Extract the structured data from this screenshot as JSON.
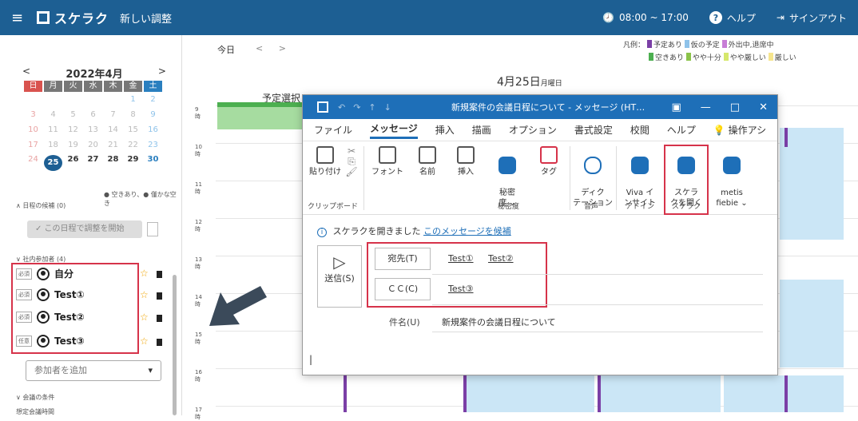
{
  "topbar": {
    "app_name": "スケラク",
    "page_title": "新しい調整",
    "hours": "08:00 ~ 17:00",
    "help": "ヘルプ",
    "signout": "サインアウト"
  },
  "calendar_mini": {
    "month_label": "2022年4月",
    "prev": "<",
    "next": ">",
    "weekdays": [
      "日",
      "月",
      "火",
      "水",
      "木",
      "金",
      "土"
    ],
    "weeks": [
      [
        "",
        "",
        "",
        "",
        "",
        "1",
        "2"
      ],
      [
        "3",
        "4",
        "5",
        "6",
        "7",
        "8",
        "9"
      ],
      [
        "10",
        "11",
        "12",
        "13",
        "14",
        "15",
        "16"
      ],
      [
        "17",
        "18",
        "19",
        "20",
        "21",
        "22",
        "23"
      ],
      [
        "24",
        "25",
        "26",
        "27",
        "28",
        "29",
        "30"
      ]
    ],
    "legend": "● 空きあり、● 僅かな空き"
  },
  "left": {
    "candidates_label": "∧ 日程の候補 (0)",
    "start_button": "✓ この日程で調整を開始",
    "participants_label": "∨ 社内参加者 (4)",
    "participants": [
      {
        "tag": "必須",
        "name": "自分"
      },
      {
        "tag": "必須",
        "name": "Test①"
      },
      {
        "tag": "必須",
        "name": "Test②"
      },
      {
        "tag": "任意",
        "name": "Test③"
      }
    ],
    "add_participant": "参加者を追加",
    "conditions_label": "∨ 会議の条件",
    "meeting_time_label": "想定会議時間"
  },
  "calendar": {
    "today": "今日",
    "nav": "< >",
    "legend_prefix": "凡例：",
    "legend_row1": [
      "予定あり",
      "仮の予定",
      "外出中,退席中"
    ],
    "legend_row2": [
      "空きあり",
      "やや十分",
      "やや厳しい",
      "厳しい"
    ],
    "legend_colors": [
      "#7b3fa6",
      "#8fc3ea",
      "#c77dd6",
      "#4caf50",
      "#8bc34a",
      "#d6e86c",
      "#f6e58d"
    ],
    "date_title": "4月25日",
    "date_weekday": "月曜日",
    "pick_label": "予定選択",
    "hours": [
      "9時",
      "10時",
      "11時",
      "12時",
      "13時",
      "14時",
      "15時",
      "16時",
      "17時"
    ]
  },
  "outlook": {
    "window_title": "新規案件の会議日程について - メッセージ (HT…",
    "menu": [
      "ファイル",
      "メッセージ",
      "挿入",
      "描画",
      "オプション",
      "書式設定",
      "校閲",
      "ヘルプ",
      "操作アシ"
    ],
    "ribbon": {
      "paste": "貼り付け",
      "font": "フォント",
      "name": "名前",
      "insert": "挿入",
      "sensitivity": "秘密\n度 ⌄",
      "tag": "タグ",
      "dictation": "ディク\nテーション",
      "viva": "Viva イ\nンサイト",
      "scrakl_open": "スケラ\nクを開く",
      "metis": "metis\nfiebie ⌄",
      "group_clipboard": "クリップボード",
      "group_sensitivity": "秘密度",
      "group_voice": "音声",
      "group_addin": "アドイン",
      "group_scrakl": "スケラク"
    },
    "info_text": "スケラクを開きました",
    "info_link": "このメッセージを候補",
    "send": "送信(S)",
    "to_label": "宛先(T)",
    "cc_label": "ＣＣ(C)",
    "to_values": [
      "Test①",
      "Test②"
    ],
    "cc_values": [
      "Test③"
    ],
    "subject_label": "件名(U)",
    "subject_value": "新規案件の会議日程について"
  }
}
